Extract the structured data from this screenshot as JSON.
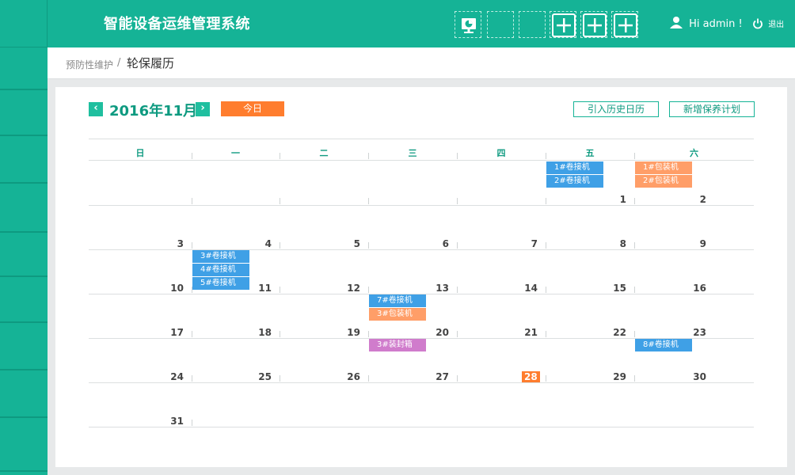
{
  "header": {
    "title": "智能设备运维管理系统",
    "greeting": "Hi admin !",
    "logout_label": "退出",
    "toolbar_icons": [
      "monitor-chart-icon",
      "blank",
      "blank",
      "add-icon",
      "add-icon",
      "add-icon"
    ]
  },
  "breadcrumb": {
    "parent": "预防性维护",
    "separator": "/",
    "current": "轮保履历"
  },
  "calendar": {
    "month_label": "2016年11月",
    "prev_label": "‹",
    "next_label": "›",
    "today_label": "今日",
    "import_history_label": "引入历史日历",
    "add_plan_label": "新增保养计划",
    "weekday_names": [
      "日",
      "一",
      "二",
      "三",
      "四",
      "五",
      "六"
    ],
    "weeks": [
      [
        null,
        null,
        null,
        null,
        null,
        "1",
        "2"
      ],
      [
        "3",
        "4",
        "5",
        "6",
        "7",
        "8",
        "9"
      ],
      [
        "10",
        "11",
        "12",
        "13",
        "14",
        "15",
        "16"
      ],
      [
        "17",
        "18",
        "19",
        "20",
        "21",
        "22",
        "23"
      ],
      [
        "24",
        "25",
        "26",
        "27",
        "28",
        "29",
        "30"
      ],
      [
        "31",
        null,
        null,
        null,
        null,
        null,
        null
      ]
    ],
    "today": "28",
    "events": [
      {
        "week": 0,
        "day": 5,
        "slot": 0,
        "label": "1#卷接机",
        "kind": "blue"
      },
      {
        "week": 0,
        "day": 5,
        "slot": 1,
        "label": "2#卷接机",
        "kind": "blue"
      },
      {
        "week": 0,
        "day": 6,
        "slot": 0,
        "label": "1#包装机",
        "kind": "orange"
      },
      {
        "week": 0,
        "day": 6,
        "slot": 1,
        "label": "2#包装机",
        "kind": "orange"
      },
      {
        "week": 2,
        "day": 1,
        "slot": 0,
        "label": "3#卷接机",
        "kind": "blue"
      },
      {
        "week": 2,
        "day": 1,
        "slot": 1,
        "label": "4#卷接机",
        "kind": "blue"
      },
      {
        "week": 2,
        "day": 1,
        "slot": 2,
        "label": "5#卷接机",
        "kind": "blue"
      },
      {
        "week": 3,
        "day": 3,
        "slot": 0,
        "label": "7#卷接机",
        "kind": "blue"
      },
      {
        "week": 3,
        "day": 3,
        "slot": 1,
        "label": "3#包装机",
        "kind": "orange"
      },
      {
        "week": 4,
        "day": 3,
        "slot": 0,
        "label": "3#装封箱",
        "kind": "purple"
      },
      {
        "week": 4,
        "day": 6,
        "slot": 0,
        "label": "8#卷接机",
        "kind": "blue"
      }
    ]
  },
  "colors": {
    "brand": "#15b396",
    "accent_orange": "#ff7d2e",
    "event_blue": "#3fa0e6",
    "event_orange": "#ff9e68",
    "event_purple": "#d07ccc"
  }
}
